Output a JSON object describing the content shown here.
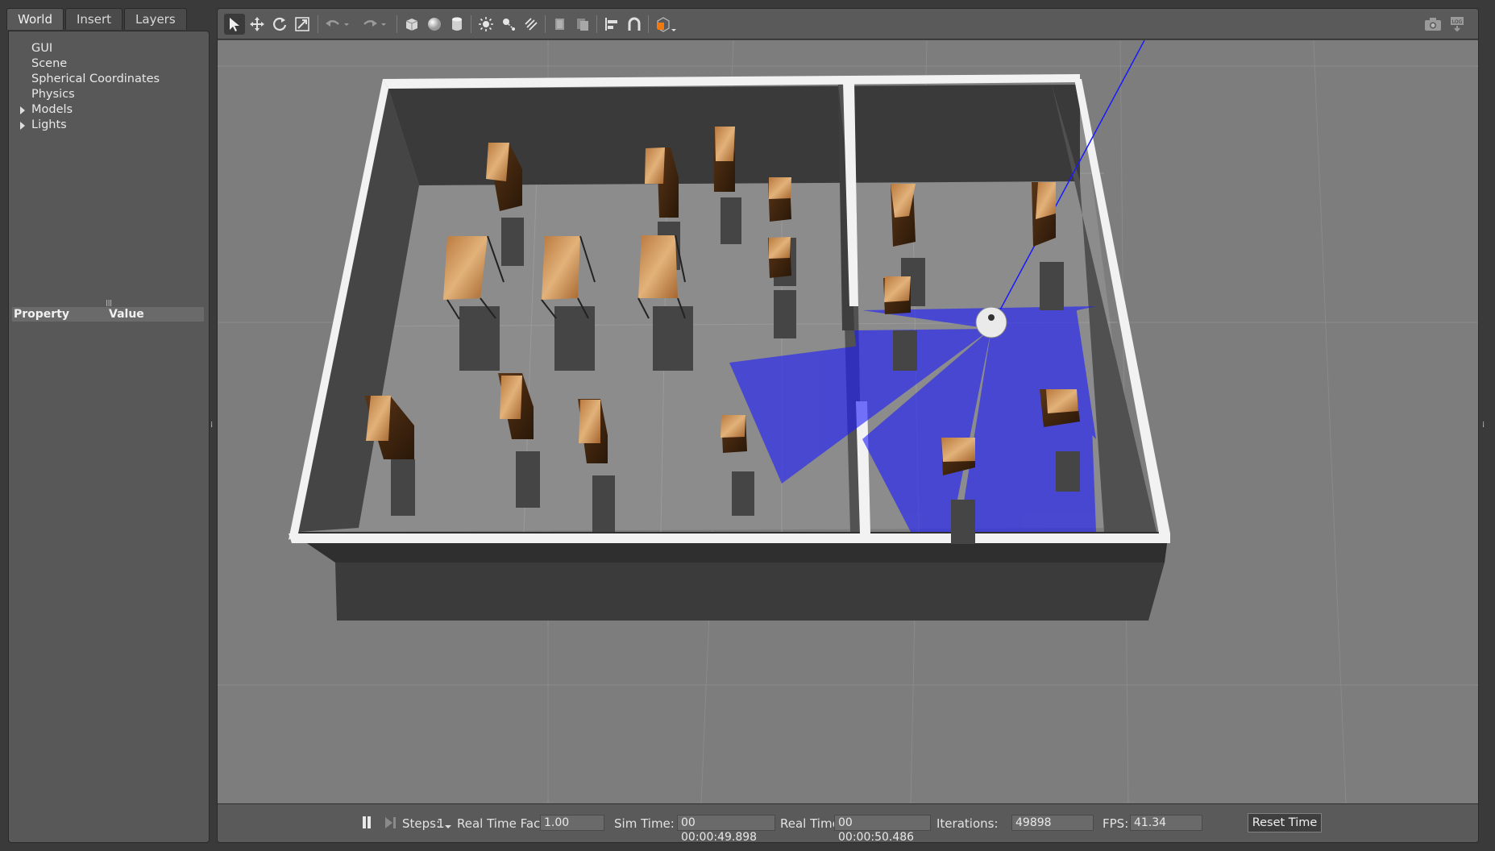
{
  "tabs": [
    {
      "label": "World",
      "active": true
    },
    {
      "label": "Insert",
      "active": false
    },
    {
      "label": "Layers",
      "active": false
    }
  ],
  "tree": [
    {
      "label": "GUI",
      "expandable": false
    },
    {
      "label": "Scene",
      "expandable": false
    },
    {
      "label": "Spherical Coordinates",
      "expandable": false
    },
    {
      "label": "Physics",
      "expandable": false
    },
    {
      "label": "Models",
      "expandable": true
    },
    {
      "label": "Lights",
      "expandable": true
    }
  ],
  "properties": {
    "col_property": "Property",
    "col_value": "Value"
  },
  "toolbar": {
    "icons": [
      "select-icon",
      "translate-icon",
      "rotate-icon",
      "scale-icon",
      "undo-icon",
      "undo-history-icon",
      "redo-icon",
      "redo-history-icon",
      "box-icon",
      "sphere-icon",
      "cylinder-icon",
      "point-light-icon",
      "spot-light-icon",
      "directional-light-icon",
      "copy-icon",
      "paste-icon",
      "align-icon",
      "snap-icon",
      "view-angle-icon",
      "screenshot-icon",
      "log-icon"
    ]
  },
  "bottom": {
    "steps_label": "Steps:",
    "steps_value": "1",
    "rtf_label": "Real Time Factor:",
    "rtf_value": "1.00",
    "sim_label": "Sim Time:",
    "sim_value": "00 00:00:49.898",
    "real_label": "Real Time:",
    "real_value": "00 00:00:50.486",
    "iter_label": "Iterations:",
    "iter_value": "49898",
    "fps_label": "FPS:",
    "fps_value": "41.34",
    "reset_label": "Reset Time"
  },
  "colors": {
    "laser": "#1a1aff",
    "wall_top": "#f2f2f2",
    "wall_side": "#3a3a3a",
    "floor": "#8a8a8a",
    "ground": "#7d7d7d",
    "wood": "#c9894a"
  }
}
